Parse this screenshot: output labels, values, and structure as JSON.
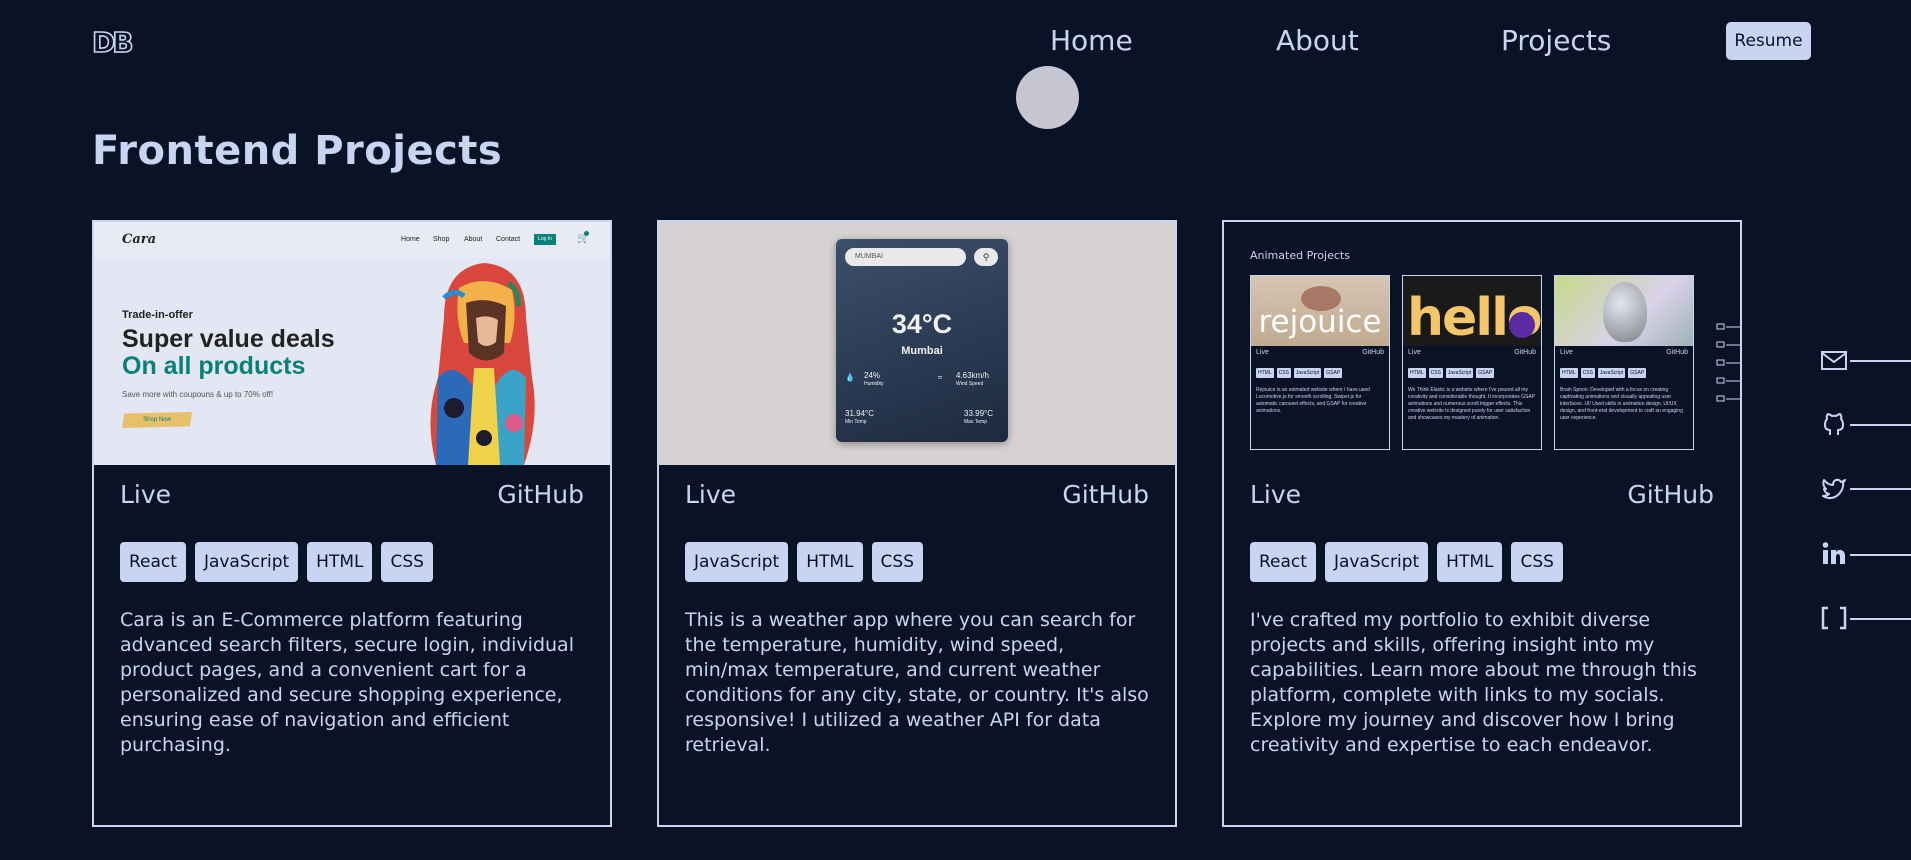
{
  "header": {
    "logo": "DB",
    "nav": [
      "Home",
      "About",
      "Projects"
    ],
    "resume_label": "Resume"
  },
  "section_title": "Frontend Projects",
  "projects": [
    {
      "live_label": "Live",
      "github_label": "GitHub",
      "tags": [
        "React",
        "JavaScript",
        "HTML",
        "CSS"
      ],
      "description": "Cara is an E-Commerce platform featuring advanced search filters, secure login, individual product pages, and a convenient cart for a personalized and secure shopping experience, ensuring ease of navigation and efficient purchasing.",
      "preview": {
        "brand": "Cara",
        "nav": [
          "Home",
          "Shop",
          "About",
          "Contact"
        ],
        "login": "Log In",
        "trade": "Trade-in-offer",
        "headline_1": "Super value deals",
        "headline_2": "On all products",
        "subtext": "Save more with coupouns & up to 70% off!",
        "cta": "Shop Now"
      }
    },
    {
      "live_label": "Live",
      "github_label": "GitHub",
      "tags": [
        "JavaScript",
        "HTML",
        "CSS"
      ],
      "description": "This is a weather app where you can search for the temperature, humidity, wind speed, min/max temperature, and current weather conditions for any city, state, or country. It's also responsive! I utilized a weather API for data retrieval.",
      "preview": {
        "search_value": "MUMBAI",
        "temperature": "34°C",
        "city": "Mumbai",
        "humidity_value": "24%",
        "humidity_label": "Humidity",
        "wind_value": "4.63km/h",
        "wind_label": "Wind Speed",
        "min_value": "31.94°C",
        "min_label": "Min Temp",
        "max_value": "33.99°C",
        "max_label": "Max Temp"
      }
    },
    {
      "live_label": "Live",
      "github_label": "GitHub",
      "tags": [
        "React",
        "JavaScript",
        "HTML",
        "CSS"
      ],
      "description": "I've crafted my portfolio to exhibit diverse projects and skills, offering insight into my capabilities. Learn more about me through this platform, complete with links to my socials. Explore my journey and discover how I bring creativity and expertise to each endeavor.",
      "preview": {
        "label": "Animated Projects",
        "mini_cards": [
          {
            "image_text": "rejouice",
            "live": "Live",
            "github": "GitHub",
            "tags": [
              "HTML",
              "CSS",
              "JavaScript",
              "GSAP"
            ],
            "desc": "Rejouice is an animated website where I have used Locomotive.js for smooth scrolling, Swiper.js for automatic carousel effects, and GSAP for creative animations."
          },
          {
            "image_text": "hello",
            "live": "Live",
            "github": "GitHub",
            "tags": [
              "HTML",
              "CSS",
              "JavaScript",
              "GSAP"
            ],
            "desc": "We Think Elastic is a website where I've poured all my creativity and considerable thought. It incorporates GSAP animations and numerous scroll trigger effects. This creative website is designed purely for user satisfaction and showcases my mastery of animation."
          },
          {
            "image_text": "",
            "live": "Live",
            "github": "GitHub",
            "tags": [
              "HTML",
              "CSS",
              "JavaScript",
              "GSAP"
            ],
            "desc": "Brain Spoon: Developed with a focus on creating captivating animations and visually appealing user interfaces. UI/ Used skills in animation design, UI/UX design, and front-end development to craft an engaging user experience."
          }
        ]
      }
    }
  ],
  "social_icons": [
    "mail-icon",
    "github-icon",
    "twitter-icon",
    "linkedin-icon",
    "brackets-icon"
  ],
  "colors": {
    "background": "#0a1325",
    "text": "#c9d4f2",
    "accent_green": "#088178"
  }
}
